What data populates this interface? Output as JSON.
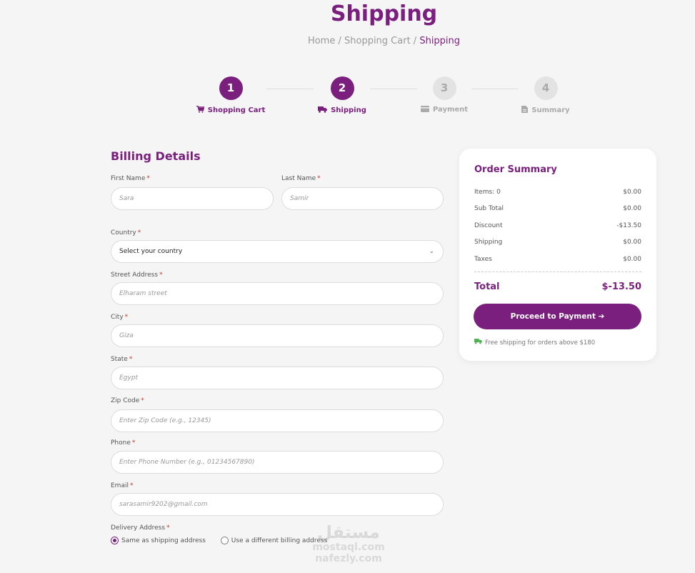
{
  "page": {
    "title": "Shipping",
    "breadcrumb": {
      "home": "Home",
      "sep1": " / ",
      "cart": "Shopping Cart",
      "sep2": " / ",
      "current": "Shipping"
    }
  },
  "steps": [
    {
      "number": "1",
      "label": "Shopping Cart",
      "icon": "cart-icon",
      "active": true
    },
    {
      "number": "2",
      "label": "Shipping",
      "icon": "truck-icon",
      "active": true
    },
    {
      "number": "3",
      "label": "Payment",
      "icon": "credit-card-icon",
      "active": false
    },
    {
      "number": "4",
      "label": "Summary",
      "icon": "document-icon",
      "active": false
    }
  ],
  "billing": {
    "title": "Billing Details",
    "first_name": {
      "label": "First Name",
      "placeholder": "Sara"
    },
    "last_name": {
      "label": "Last Name",
      "placeholder": "Samir"
    },
    "country": {
      "label": "Country",
      "value": "Select your country"
    },
    "street": {
      "label": "Street Address",
      "placeholder": "Elharam street"
    },
    "city": {
      "label": "City",
      "placeholder": "Giza"
    },
    "state": {
      "label": "State",
      "placeholder": "Egypt"
    },
    "zip": {
      "label": "Zip Code",
      "placeholder": "Enter Zip Code (e.g., 12345)"
    },
    "phone": {
      "label": "Phone",
      "placeholder": "Enter Phone Number (e.g., 01234567890)"
    },
    "email": {
      "label": "Email",
      "placeholder": "sarasamir9202@gmail.com"
    },
    "required_mark": "*",
    "delivery": {
      "label": "Delivery Address",
      "option_same": "Same as shipping address",
      "option_different": "Use a different billing address",
      "selected": "same"
    }
  },
  "summary": {
    "title": "Order Summary",
    "rows": [
      {
        "label": "Items: 0",
        "value": "$0.00"
      },
      {
        "label": "Sub Total",
        "value": "$0.00"
      },
      {
        "label": "Discount",
        "value": "-$13.50"
      },
      {
        "label": "Shipping",
        "value": "$0.00"
      },
      {
        "label": "Taxes",
        "value": "$0.00"
      }
    ],
    "total_label": "Total",
    "total_value": "$-13.50",
    "button_label": "Proceed to Payment ➔",
    "note": "Free shipping for orders above $180"
  },
  "watermark": {
    "arabic": "مستقل",
    "line1": "mostaql.com",
    "line2": "nafezly.com"
  },
  "colors": {
    "accent": "#7b1f7f",
    "inactive": "#e3e3e3",
    "ship_icon": "#4caf50"
  }
}
